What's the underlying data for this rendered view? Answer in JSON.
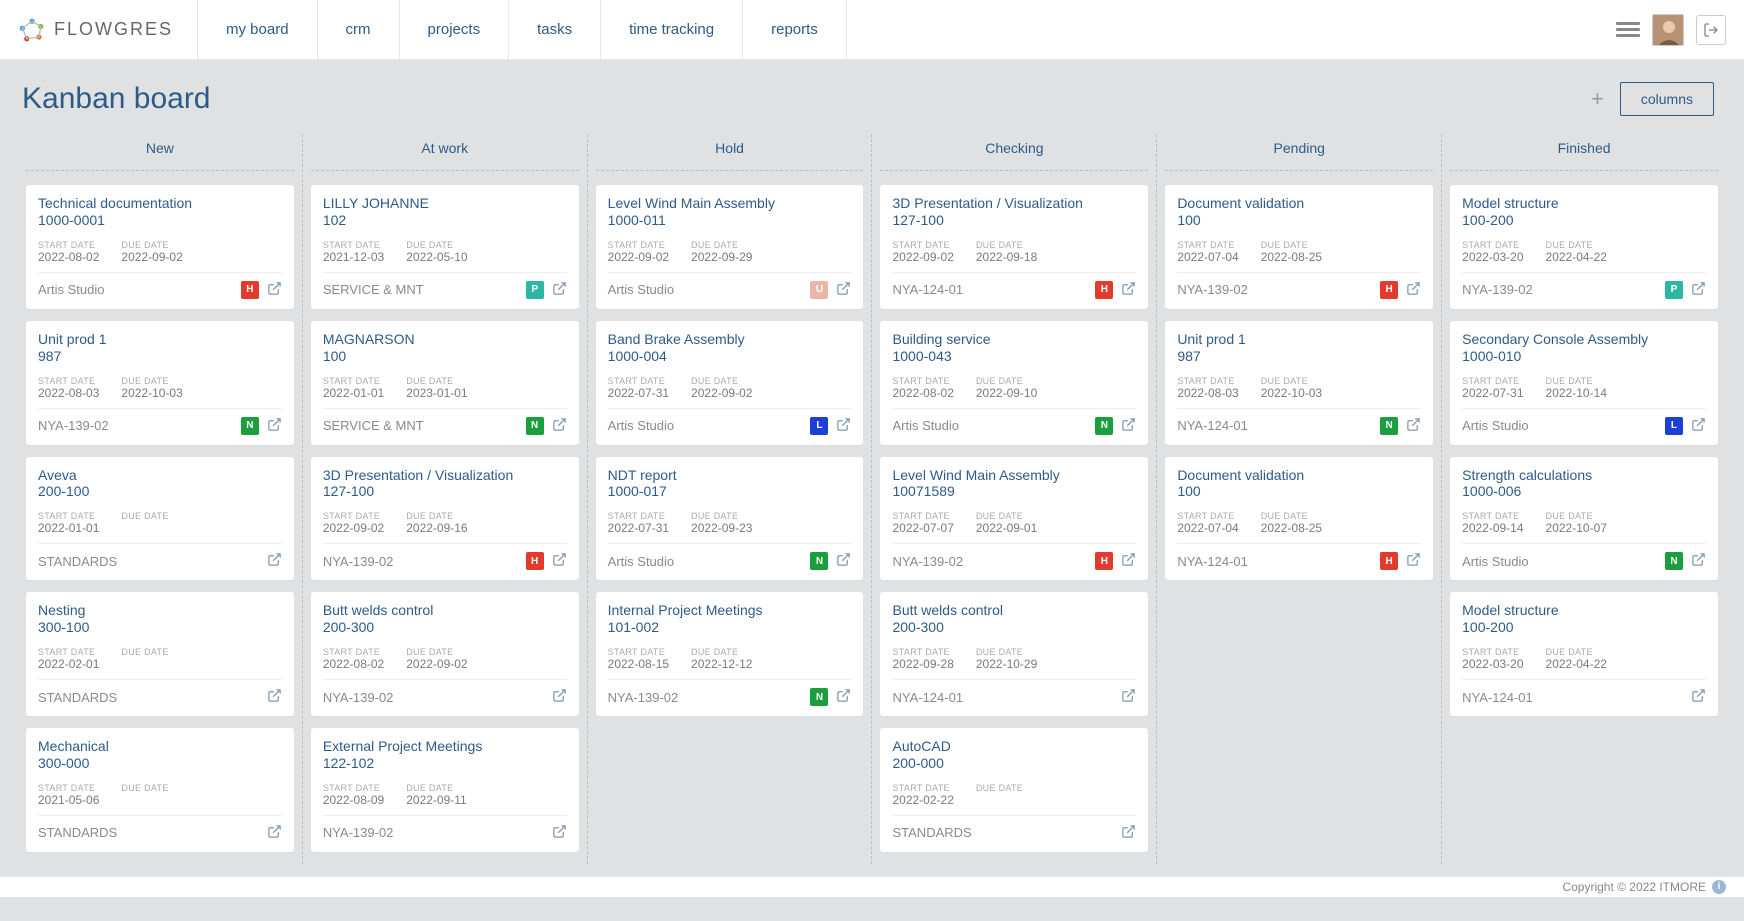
{
  "brand": "FLOWGRES",
  "nav": [
    "my board",
    "crm",
    "projects",
    "tasks",
    "time tracking",
    "reports"
  ],
  "page_title": "Kanban board",
  "buttons": {
    "columns": "columns"
  },
  "labels": {
    "start": "START DATE",
    "due": "DUE DATE"
  },
  "footer": "Copyright © 2022 ITMORE",
  "lanes": [
    {
      "name": "New",
      "cards": [
        {
          "title": "Technical documentation",
          "code": "1000-0001",
          "start": "2022-08-02",
          "due": "2022-09-02",
          "footer": "Artis Studio",
          "badge": "H"
        },
        {
          "title": "Unit prod 1",
          "code": "987",
          "start": "2022-08-03",
          "due": "2022-10-03",
          "footer": "NYA-139-02",
          "badge": "N"
        },
        {
          "title": "Aveva",
          "code": "200-100",
          "start": "2022-01-01",
          "due": "",
          "footer": "STANDARDS",
          "badge": ""
        },
        {
          "title": "Nesting",
          "code": "300-100",
          "start": "2022-02-01",
          "due": "",
          "footer": "STANDARDS",
          "badge": ""
        },
        {
          "title": "Mechanical",
          "code": "300-000",
          "start": "2021-05-06",
          "due": "",
          "footer": "STANDARDS",
          "badge": ""
        }
      ]
    },
    {
      "name": "At work",
      "cards": [
        {
          "title": "LILLY JOHANNE",
          "code": "102",
          "start": "2021-12-03",
          "due": "2022-05-10",
          "footer": "SERVICE & MNT",
          "badge": "P"
        },
        {
          "title": "MAGNARSON",
          "code": "100",
          "start": "2022-01-01",
          "due": "2023-01-01",
          "footer": "SERVICE & MNT",
          "badge": "N"
        },
        {
          "title": "3D Presentation / Visualization",
          "code": "127-100",
          "start": "2022-09-02",
          "due": "2022-09-16",
          "footer": "NYA-139-02",
          "badge": "H"
        },
        {
          "title": "Butt welds control",
          "code": "200-300",
          "start": "2022-08-02",
          "due": "2022-09-02",
          "footer": "NYA-139-02",
          "badge": ""
        },
        {
          "title": "External Project Meetings",
          "code": "122-102",
          "start": "2022-08-09",
          "due": "2022-09-11",
          "footer": "NYA-139-02",
          "badge": ""
        }
      ]
    },
    {
      "name": "Hold",
      "cards": [
        {
          "title": "Level Wind Main Assembly",
          "code": "1000-011",
          "start": "2022-09-02",
          "due": "2022-09-29",
          "footer": "Artis Studio",
          "badge": "U"
        },
        {
          "title": "Band Brake Assembly",
          "code": "1000-004",
          "start": "2022-07-31",
          "due": "2022-09-02",
          "footer": "Artis Studio",
          "badge": "L"
        },
        {
          "title": "NDT report",
          "code": "1000-017",
          "start": "2022-07-31",
          "due": "2022-09-23",
          "footer": "Artis Studio",
          "badge": "N"
        },
        {
          "title": "Internal Project Meetings",
          "code": "101-002",
          "start": "2022-08-15",
          "due": "2022-12-12",
          "footer": "NYA-139-02",
          "badge": "N"
        }
      ]
    },
    {
      "name": "Checking",
      "cards": [
        {
          "title": "3D Presentation / Visualization",
          "code": "127-100",
          "start": "2022-09-02",
          "due": "2022-09-18",
          "footer": "NYA-124-01",
          "badge": "H"
        },
        {
          "title": "Building service",
          "code": "1000-043",
          "start": "2022-08-02",
          "due": "2022-09-10",
          "footer": "Artis Studio",
          "badge": "N"
        },
        {
          "title": "Level Wind Main Assembly",
          "code": "10071589",
          "start": "2022-07-07",
          "due": "2022-09-01",
          "footer": "NYA-139-02",
          "badge": "H"
        },
        {
          "title": "Butt welds control",
          "code": "200-300",
          "start": "2022-09-28",
          "due": "2022-10-29",
          "footer": "NYA-124-01",
          "badge": ""
        },
        {
          "title": "AutoCAD",
          "code": "200-000",
          "start": "2022-02-22",
          "due": "",
          "footer": "STANDARDS",
          "badge": ""
        }
      ]
    },
    {
      "name": "Pending",
      "cards": [
        {
          "title": "Document validation",
          "code": "100",
          "start": "2022-07-04",
          "due": "2022-08-25",
          "footer": "NYA-139-02",
          "badge": "H"
        },
        {
          "title": "Unit prod 1",
          "code": "987",
          "start": "2022-08-03",
          "due": "2022-10-03",
          "footer": "NYA-124-01",
          "badge": "N"
        },
        {
          "title": "Document validation",
          "code": "100",
          "start": "2022-07-04",
          "due": "2022-08-25",
          "footer": "NYA-124-01",
          "badge": "H"
        }
      ]
    },
    {
      "name": "Finished",
      "cards": [
        {
          "title": "Model structure",
          "code": "100-200",
          "start": "2022-03-20",
          "due": "2022-04-22",
          "footer": "NYA-139-02",
          "badge": "P"
        },
        {
          "title": "Secondary Console Assembly",
          "code": "1000-010",
          "start": "2022-07-31",
          "due": "2022-10-14",
          "footer": "Artis Studio",
          "badge": "L"
        },
        {
          "title": "Strength calculations",
          "code": "1000-006",
          "start": "2022-09-14",
          "due": "2022-10-07",
          "footer": "Artis Studio",
          "badge": "N"
        },
        {
          "title": "Model structure",
          "code": "100-200",
          "start": "2022-03-20",
          "due": "2022-04-22",
          "footer": "NYA-124-01",
          "badge": ""
        }
      ]
    }
  ]
}
